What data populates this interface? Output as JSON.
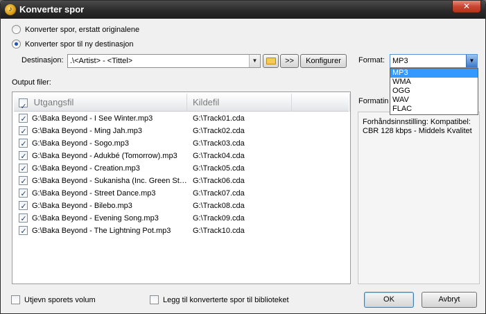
{
  "window": {
    "title": "Konverter spor",
    "close_glyph": "✕",
    "icon_glyph": "♪"
  },
  "options": {
    "replace_label": "Konverter spor, erstatt originalene",
    "new_dest_label": "Konverter spor til ny destinasjon",
    "selected": "new_dest"
  },
  "destination": {
    "label": "Destinasjon:",
    "value": ".\\<Artist> - <Tittel>",
    "browse_glyph": ">>",
    "configure_label": "Konfigurer"
  },
  "format": {
    "label": "Format:",
    "value": "MP3",
    "options": [
      "MP3",
      "WMA",
      "OGG",
      "WAV",
      "FLAC"
    ],
    "selected_index": 0
  },
  "output": {
    "label": "Output filer:",
    "columns": [
      "Utgangsfil",
      "Kildefil"
    ],
    "rows": [
      {
        "file": "G:\\Baka Beyond - I See Winter.mp3",
        "source": "G:\\Track01.cda",
        "checked": true
      },
      {
        "file": "G:\\Baka Beyond - Ming Jah.mp3",
        "source": "G:\\Track02.cda",
        "checked": true
      },
      {
        "file": "G:\\Baka Beyond - Sogo.mp3",
        "source": "G:\\Track03.cda",
        "checked": true
      },
      {
        "file": "G:\\Baka Beyond - Adukbé (Tomorrow).mp3",
        "source": "G:\\Track04.cda",
        "checked": true
      },
      {
        "file": "G:\\Baka Beyond - Creation.mp3",
        "source": "G:\\Track05.cda",
        "checked": true
      },
      {
        "file": "G:\\Baka Beyond - Sukanisha (Inc. Green St…",
        "source": "G:\\Track06.cda",
        "checked": true
      },
      {
        "file": "G:\\Baka Beyond - Street Dance.mp3",
        "source": "G:\\Track07.cda",
        "checked": true
      },
      {
        "file": "G:\\Baka Beyond - Bilebo.mp3",
        "source": "G:\\Track08.cda",
        "checked": true
      },
      {
        "file": "G:\\Baka Beyond - Evening Song.mp3",
        "source": "G:\\Track09.cda",
        "checked": true
      },
      {
        "file": "G:\\Baka Beyond - The Lightning Pot.mp3",
        "source": "G:\\Track10.cda",
        "checked": true
      }
    ]
  },
  "format_info": {
    "group_label": "Formatinnstillinger",
    "text": "Forhåndsinnstilling: Kompatibel: CBR 128 kbps - Middels Kvalitet"
  },
  "footer": {
    "normalize_label": "Utjevn sporets volum",
    "add_library_label": "Legg til konverterte spor til biblioteket",
    "ok_label": "OK",
    "cancel_label": "Avbryt"
  },
  "icons": {
    "app": "app-icon",
    "folder": "folder-icon",
    "dropdown_arrow": "chevron-down-icon",
    "check": "checkmark-icon"
  }
}
